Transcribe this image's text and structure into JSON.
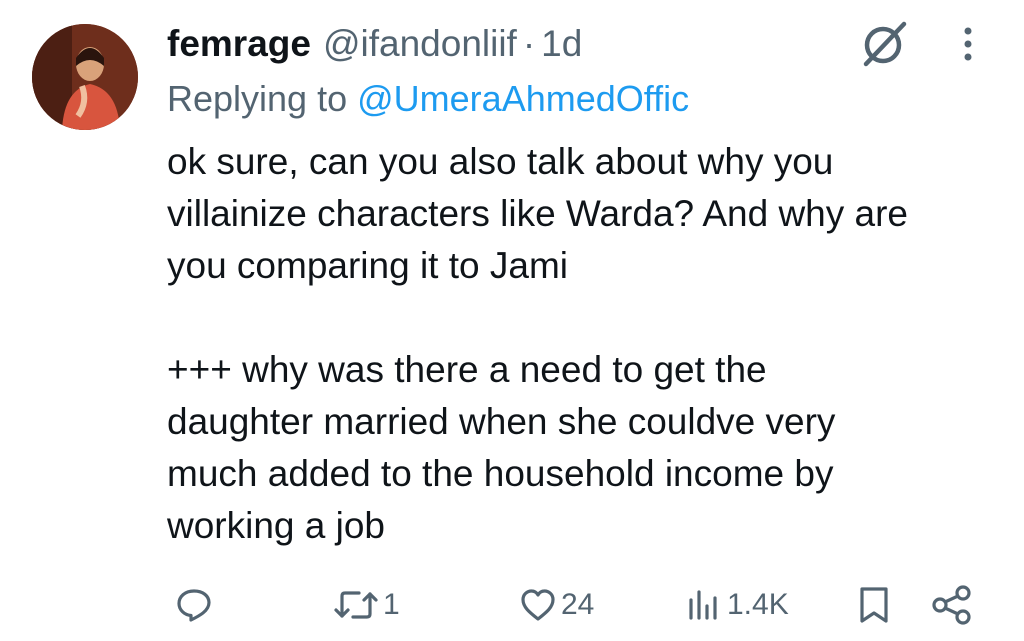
{
  "tweet": {
    "author": {
      "display_name": "femrage",
      "handle": "@ifandonliif",
      "separator": "·",
      "time": "1d"
    },
    "replying_to": {
      "prefix": "Replying to",
      "mention": "@UmeraAhmedOffic"
    },
    "body": [
      "ok sure, can you also talk about why you",
      "villainize characters like Warda? And why are",
      "you comparing it to Jami",
      "",
      "+++ why was there a need to get the",
      "daughter married when she couldve very",
      "much added to the household income by",
      "working a job"
    ],
    "actions": {
      "reply": {
        "icon": "reply-icon",
        "count": ""
      },
      "retweet": {
        "icon": "retweet-icon",
        "count": "1"
      },
      "like": {
        "icon": "heart-icon",
        "count": "24"
      },
      "views": {
        "icon": "views-icon",
        "count": "1.4K"
      },
      "bookmark": {
        "icon": "bookmark-icon",
        "count": ""
      },
      "share": {
        "icon": "share-icon",
        "count": ""
      }
    }
  },
  "colors": {
    "text": "#0f1419",
    "muted": "#536471",
    "link": "#1d9bf0",
    "background": "#ffffff"
  }
}
